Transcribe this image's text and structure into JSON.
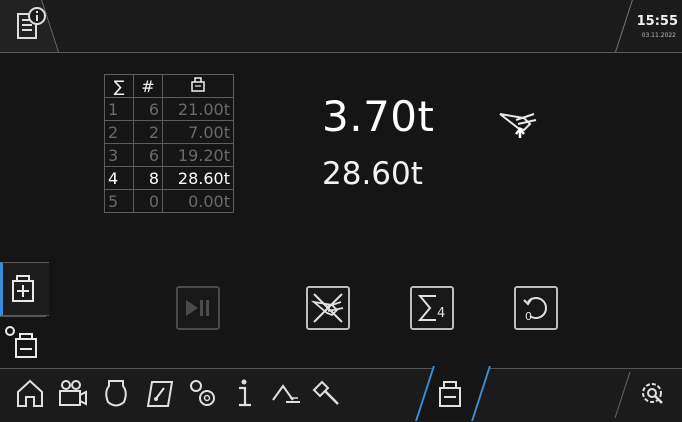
{
  "header": {
    "time": "15:55",
    "date": "03.11.2022"
  },
  "table": {
    "headers": [
      "∑",
      "#",
      "⚖"
    ],
    "rows": [
      {
        "idx": "1",
        "count": "6",
        "weight": "21.00t",
        "active": false
      },
      {
        "idx": "2",
        "count": "2",
        "weight": "7.00t",
        "active": false
      },
      {
        "idx": "3",
        "count": "6",
        "weight": "19.20t",
        "active": false
      },
      {
        "idx": "4",
        "count": "8",
        "weight": "28.60t",
        "active": true
      },
      {
        "idx": "5",
        "count": "0",
        "weight": "0.00t",
        "active": false
      }
    ]
  },
  "display": {
    "current_load": "3.70t",
    "sum_load": "28.60t"
  },
  "actions": {
    "sum_button_label": "4",
    "reset_button_label": "0"
  },
  "colors": {
    "accent": "#3a8fd8",
    "background": "#151515",
    "active_text": "#ffffff",
    "inactive_text": "#6a6a6a"
  },
  "icons": {
    "top_left": "document-info-icon",
    "crane": "crane-hook-up-icon",
    "nav": [
      "home-icon",
      "camera-icon",
      "bucket-icon",
      "gauge-icon",
      "gears-icon",
      "info-icon",
      "level-icon",
      "hammer-icon",
      "weighing-icon",
      "settings-icon"
    ]
  }
}
